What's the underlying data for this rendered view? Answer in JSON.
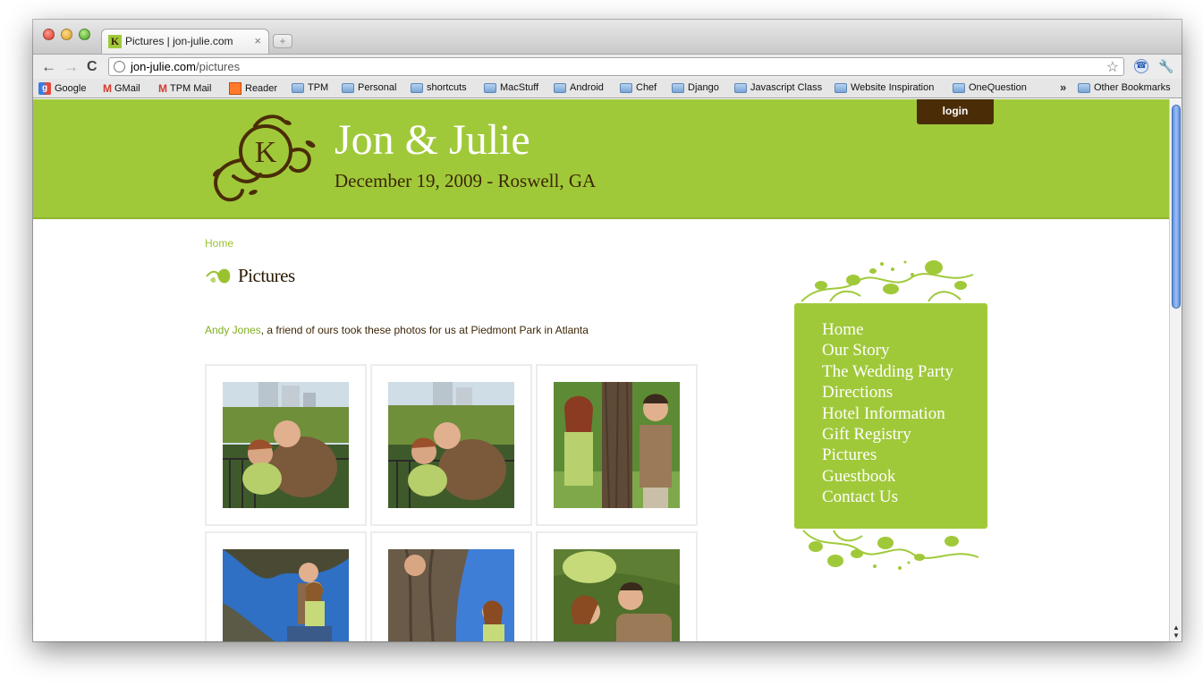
{
  "browser": {
    "tab_title": "Pictures | jon-julie.com",
    "tab_favicon_letter": "K",
    "tab_close": "×",
    "new_tab": "+",
    "url_host": "jon-julie.com",
    "url_path": "/pictures",
    "bookmarks": [
      {
        "label": "Google",
        "icon": "google-icon"
      },
      {
        "label": "GMail",
        "icon": "gmail-icon"
      },
      {
        "label": "TPM Mail",
        "icon": "gmail-icon"
      },
      {
        "label": "Reader",
        "icon": "reader-icon"
      },
      {
        "label": "TPM",
        "icon": "folder-icon"
      },
      {
        "label": "Personal",
        "icon": "folder-icon"
      },
      {
        "label": "shortcuts",
        "icon": "folder-icon"
      },
      {
        "label": "MacStuff",
        "icon": "folder-icon"
      },
      {
        "label": "Android",
        "icon": "folder-icon"
      },
      {
        "label": "Chef",
        "icon": "folder-icon"
      },
      {
        "label": "Django",
        "icon": "folder-icon"
      },
      {
        "label": "Javascript Class",
        "icon": "folder-icon"
      },
      {
        "label": "Website Inspiration",
        "icon": "folder-icon"
      },
      {
        "label": "OneQuestion",
        "icon": "folder-icon"
      }
    ],
    "bookmarks_overflow": "»",
    "other_bookmarks": "Other Bookmarks"
  },
  "site": {
    "title": "Jon & Julie",
    "date_line": "December 19, 2009 - Roswell, GA",
    "logo_letter": "K",
    "login_label": "login",
    "accent_color": "#a0c93a",
    "brown_color": "#4a2d07"
  },
  "content": {
    "breadcrumb": "Home",
    "heading": "Pictures",
    "intro_link": "Andy Jones",
    "intro_text": ", a friend of ours took these photos for us at Piedmont Park in Atlanta",
    "photos": [
      {
        "name": "kiss-at-railing-photo"
      },
      {
        "name": "kiss-at-railing-alt-photo"
      },
      {
        "name": "tree-peek-photo"
      },
      {
        "name": "sitting-on-tree-photo"
      },
      {
        "name": "tree-trunk-photo"
      },
      {
        "name": "lying-on-grass-photo"
      }
    ]
  },
  "sidebar": {
    "nav": [
      "Home",
      "Our Story",
      "The Wedding Party",
      "Directions",
      "Hotel Information",
      "Gift Registry",
      "Pictures",
      "Guestbook",
      "Contact Us"
    ]
  }
}
